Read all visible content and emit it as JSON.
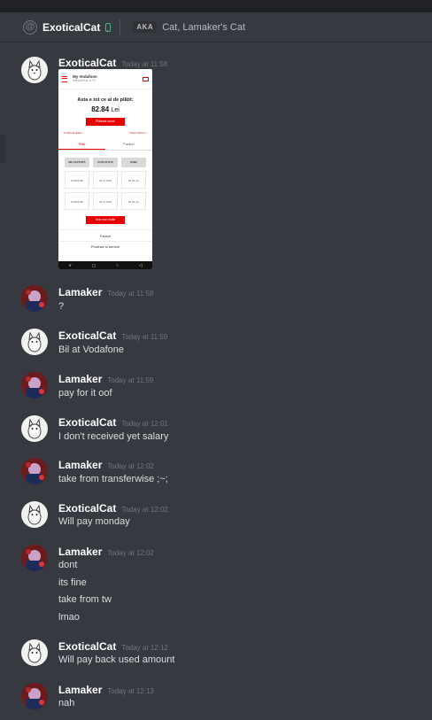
{
  "header": {
    "channel_name": "ExoticalCat",
    "aka_label": "AKA",
    "aka_names": "Cat, Lamaker's Cat"
  },
  "icons": {
    "at": "at-icon",
    "mobile": "mobile-phone-icon",
    "status_color": "#43b581"
  },
  "colors": {
    "background": "#36393f",
    "username": "#ffffff",
    "timestamp": "#72767d",
    "vodafone_red": "#e60000"
  },
  "attachment": {
    "brand": "My Vodafone",
    "brand_sub": "Servicii fixe & TV",
    "title": "Asta e tot ce ai de plătit:",
    "amount": "82.84",
    "currency": "Lei",
    "pay_button": "Plătește acum",
    "link_left": "Confirmă plata >",
    "link_right": "Istoric facturi >",
    "tab_payments": "Plăți",
    "tab_invoices": "Facturi",
    "columns": [
      "NR. FACTURĂ",
      "DATA PLĂȚII",
      "SUMA"
    ],
    "rows": [
      [
        "123456789",
        "20.12.2020",
        "82.84 Lei"
      ],
      [
        "123456789",
        "20.12.2020",
        "82.84 Lei"
      ]
    ],
    "more_button": "Vezi mai multe",
    "nav_invoices": "Facturi",
    "nav_products": "Produse și servicii",
    "android_nav": [
      "∨",
      "◻",
      "○",
      "◁"
    ]
  },
  "messages": [
    {
      "author": "ExoticalCat",
      "time": "Today at 11:58",
      "lines": []
    },
    {
      "author": "Lamaker",
      "time": "Today at 11:58",
      "lines": [
        "?"
      ]
    },
    {
      "author": "ExoticalCat",
      "time": "Today at 11:59",
      "lines": [
        "Bil at Vodafone"
      ]
    },
    {
      "author": "Lamaker",
      "time": "Today at 11:59",
      "lines": [
        "pay for it oof"
      ]
    },
    {
      "author": "ExoticalCat",
      "time": "Today at 12:01",
      "lines": [
        "I don't received yet salary"
      ]
    },
    {
      "author": "Lamaker",
      "time": "Today at 12:02",
      "lines": [
        "take from transferwise ;~;"
      ]
    },
    {
      "author": "ExoticalCat",
      "time": "Today at 12:02",
      "lines": [
        "Will pay monday"
      ]
    },
    {
      "author": "Lamaker",
      "time": "Today at 12:02",
      "lines": [
        "dont",
        "its fine",
        "take from tw",
        "lmao"
      ]
    },
    {
      "author": "ExoticalCat",
      "time": "Today at 12:12",
      "lines": [
        "Will pay back used amount"
      ]
    },
    {
      "author": "Lamaker",
      "time": "Today at 12:13",
      "lines": [
        "nah"
      ]
    }
  ]
}
